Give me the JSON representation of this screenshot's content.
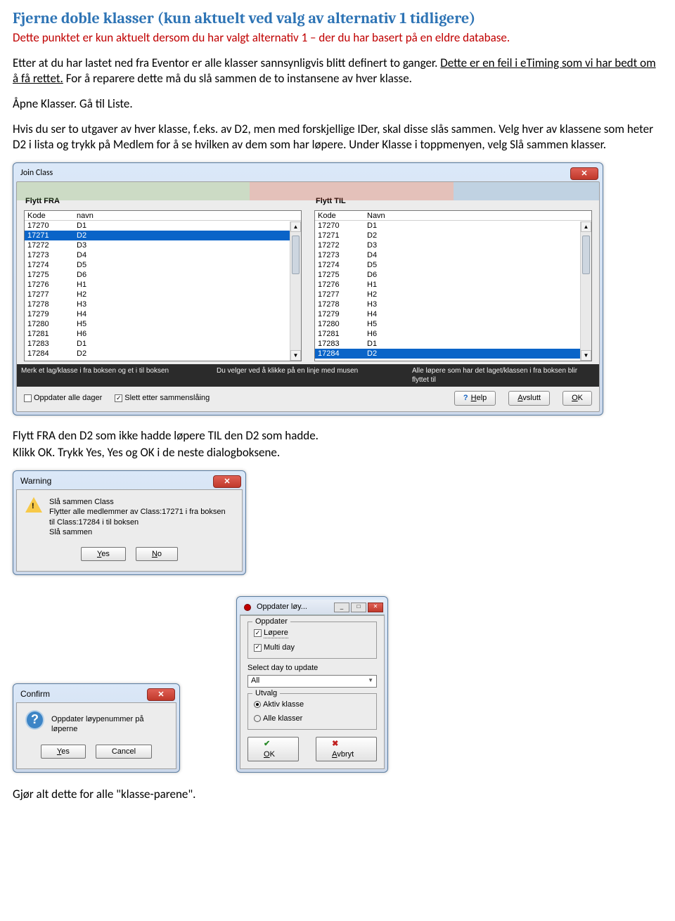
{
  "heading": "Fjerne doble klasser (kun aktuelt ved valg av alternativ 1 tidligere)",
  "intro_red": "Dette punktet er kun aktuelt dersom du har valgt alternativ 1 – der du har basert på en eldre database.",
  "p1a": "Etter at du har lastet ned fra Eventor er alle klasser sannsynligvis blitt definert to ganger. ",
  "p1b": "Dette er en feil i eTiming som vi har bedt om å få rettet.",
  "p1c": " For å reparere dette må du slå sammen de to instansene av hver klasse.",
  "p2": "Åpne Klasser. Gå til Liste.",
  "p3": "Hvis du ser to utgaver av hver klasse, f.eks. av D2, men med forskjellige IDer, skal disse slås sammen. Velg hver av klassene som heter D2 i lista og trykk på Medlem for å se hvilken av dem som har løpere. Under Klasse i toppmenyen, velg Slå sammen klasser.",
  "p4a": "Flytt FRA den D2 som ikke hadde løpere TIL den D2 som hadde.",
  "p4b": "Klikk OK. Trykk Yes, Yes og OK i de neste dialogboksene.",
  "p5": "Gjør alt dette for alle \"klasse-parene\".",
  "join": {
    "title": "Join Class",
    "from_label": "Flytt FRA",
    "to_label": "Flytt TIL",
    "col_code_l": "Kode",
    "col_name_l": "navn",
    "col_code_r": "Kode",
    "col_name_r": "Navn",
    "rows": [
      {
        "k": "17270",
        "n": "D1"
      },
      {
        "k": "17271",
        "n": "D2"
      },
      {
        "k": "17272",
        "n": "D3"
      },
      {
        "k": "17273",
        "n": "D4"
      },
      {
        "k": "17274",
        "n": "D5"
      },
      {
        "k": "17275",
        "n": "D6"
      },
      {
        "k": "17276",
        "n": "H1"
      },
      {
        "k": "17277",
        "n": "H2"
      },
      {
        "k": "17278",
        "n": "H3"
      },
      {
        "k": "17279",
        "n": "H4"
      },
      {
        "k": "17280",
        "n": "H5"
      },
      {
        "k": "17281",
        "n": "H6"
      },
      {
        "k": "17283",
        "n": "D1"
      },
      {
        "k": "17284",
        "n": "D2"
      }
    ],
    "sel_left": 1,
    "sel_right": 13,
    "hint1": "Merk et lag/klasse i fra boksen og et i til boksen",
    "hint2": "Du velger ved å klikke på en linje med musen",
    "hint3": "Alle løpere som har det laget/klassen i fra boksen blir flyttet til",
    "chk_update": "Oppdater alle dager",
    "chk_delete": "Slett etter sammenslåing",
    "btn_help": "Help",
    "btn_avslutt": "Avslutt",
    "btn_ok": "OK"
  },
  "warning": {
    "title": "Warning",
    "l1": "Slå sammen Class",
    "l2": "Flytter alle medlemmer av Class:17271 i fra boksen",
    "l3": "til Class:17284 i til boksen",
    "l4": "Slå sammen",
    "yes": "Yes",
    "no": "No"
  },
  "confirm": {
    "title": "Confirm",
    "msg": "Oppdater løypenummer på løperne",
    "yes": "Yes",
    "cancel": "Cancel"
  },
  "oppdater": {
    "title": "Oppdater løy...",
    "grp1": "Oppdater",
    "chk1": "Løpere",
    "chk2": "Multi day",
    "sel_label": "Select day to update",
    "sel_value": "All",
    "grp2": "Utvalg",
    "r1": "Aktiv klasse",
    "r2": "Alle klasser",
    "ok": "OK",
    "avbryt": "Avbryt"
  }
}
